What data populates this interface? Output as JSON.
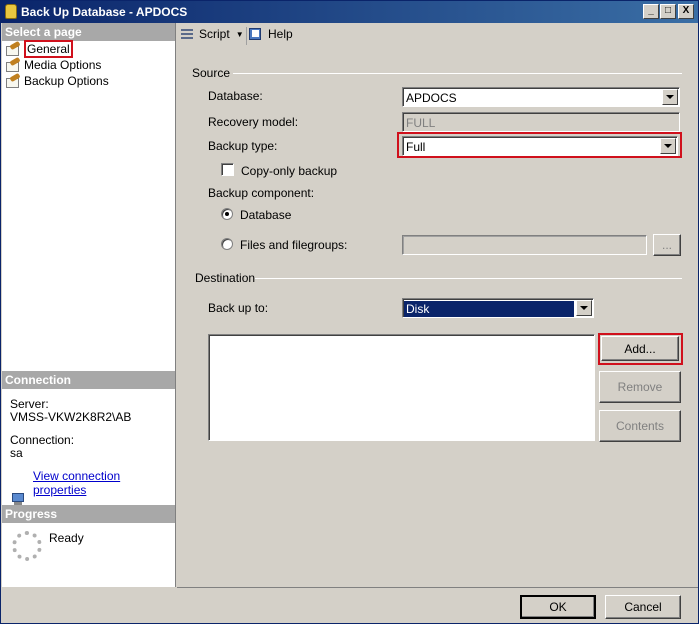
{
  "window": {
    "title": "Back Up Database - APDOCS",
    "controls": [
      "_",
      "□",
      "X"
    ]
  },
  "left_pane": {
    "select_header": "Select a page",
    "pages": [
      {
        "label": "General",
        "icon": "wrench-page-icon"
      },
      {
        "label": "Media Options",
        "icon": "wrench-page-icon"
      },
      {
        "label": "Backup Options",
        "icon": "wrench-page-icon"
      }
    ],
    "connection_header": "Connection",
    "server_label": "Server:",
    "server_value": "VMSS-VKW2K8R2\\AB",
    "connection_label": "Connection:",
    "connection_value": "sa",
    "view_link": "View connection properties",
    "progress_header": "Progress",
    "progress_status": "Ready"
  },
  "toolbar": {
    "script_label": "Script",
    "help_label": "Help"
  },
  "source": {
    "header": "Source",
    "database_label": "Database:",
    "database_value": "APDOCS",
    "recovery_label": "Recovery model:",
    "recovery_value": "FULL",
    "backup_type_label": "Backup type:",
    "backup_type_value": "Full",
    "copy_only_label": "Copy-only backup",
    "component_label": "Backup component:",
    "component_database": "Database",
    "component_files": "Files and filegroups:",
    "browse_label": "..."
  },
  "destination": {
    "header": "Destination",
    "backup_to_label": "Back up to:",
    "backup_to_value": "Disk",
    "add_label": "Add...",
    "remove_label": "Remove",
    "contents_label": "Contents"
  },
  "footer": {
    "ok_label": "OK",
    "cancel_label": "Cancel"
  },
  "colors": {
    "highlight_red": "#d0101c",
    "selection_blue": "#0a246a",
    "dialog_gray": "#d4d0c8"
  }
}
